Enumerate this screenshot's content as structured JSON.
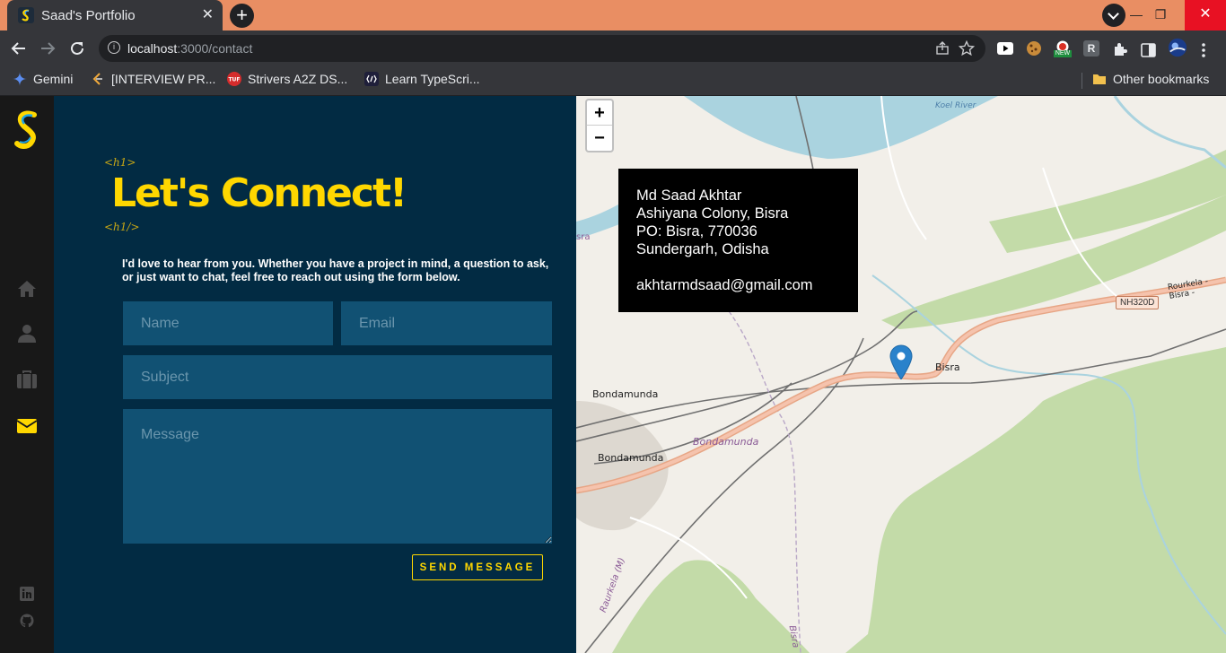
{
  "browser": {
    "tab_title": "Saad's Portfolio",
    "tab_close": "✕",
    "new_tab": "+",
    "url_host": "localhost",
    "url_path": ":3000/contact",
    "window_min": "—",
    "window_max": "❐",
    "window_close": "✕",
    "bookmarks": [
      {
        "label": "Gemini"
      },
      {
        "label": "[INTERVIEW PR..."
      },
      {
        "label": "Strivers A2Z DS..."
      },
      {
        "label": "Learn TypeScri..."
      }
    ],
    "other_bookmarks": "Other bookmarks",
    "ext_badge_new": "NEW",
    "ext_r": "R"
  },
  "contact": {
    "tag_open": "<h1>",
    "heading": "Let's Connect!",
    "tag_close": "<h1/>",
    "intro": "I'd love to hear from you. Whether you have a project in mind, a question to ask, or just want to chat, feel free to reach out using the form below.",
    "form": {
      "name_placeholder": "Name",
      "email_placeholder": "Email",
      "subject_placeholder": "Subject",
      "message_placeholder": "Message",
      "send_label": "SEND MESSAGE"
    }
  },
  "map": {
    "zoom_in": "+",
    "zoom_out": "−",
    "info": {
      "name": "Md Saad Akhtar",
      "line1": "Ashiyana Colony, Bisra",
      "line2": "PO: Bisra, 770036",
      "line3": "Sundergarh, Odisha",
      "email": "akhtarmdsaad@gmail.com"
    },
    "labels": {
      "koel_river": "Koel River",
      "nh": "NH320D",
      "road": "Rourkela - Bisra -",
      "bisra": "Bisra",
      "bondamunda_1": "Bondamunda",
      "bondamunda_2": "Bondamunda",
      "bondamunda_3": "Bondamunda",
      "rourkela": "Raurkela (M)",
      "bisra_v": "Bisra",
      "sra": "sra"
    }
  },
  "colors": {
    "accent": "#ffd700",
    "panel_bg": "#022b43",
    "input_bg": "#115173",
    "sidebar_bg": "#181818",
    "tabbar_bg": "#e98e63"
  }
}
